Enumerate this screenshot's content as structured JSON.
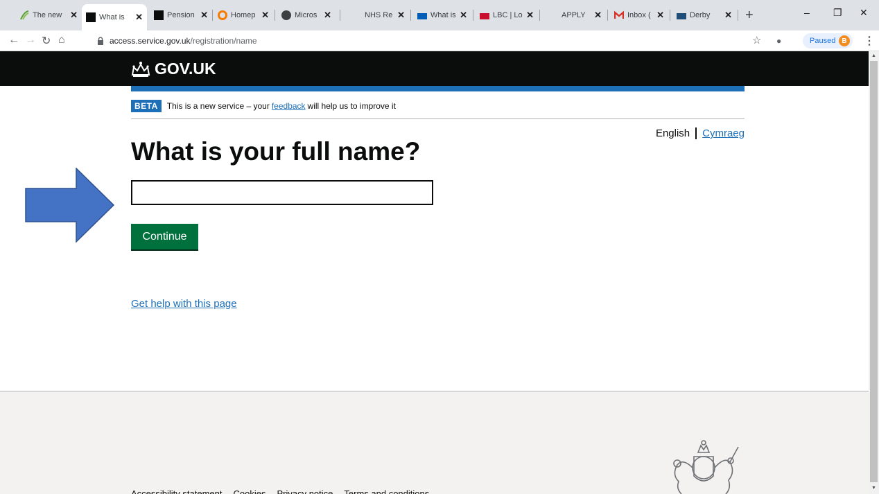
{
  "browser": {
    "tabs": [
      {
        "label": "The new",
        "active": false
      },
      {
        "label": "What is",
        "active": true
      },
      {
        "label": "Pension",
        "active": false
      },
      {
        "label": "Homep",
        "active": false
      },
      {
        "label": "Micros",
        "active": false
      },
      {
        "label": "NHS Re",
        "active": false
      },
      {
        "label": "What is",
        "active": false
      },
      {
        "label": "LBC | Lo",
        "active": false
      },
      {
        "label": "APPLY",
        "active": false
      },
      {
        "label": "Inbox (",
        "active": false
      },
      {
        "label": "Derby",
        "active": false
      }
    ],
    "close_glyph": "✕",
    "new_tab": "+",
    "url_host": "access.service.gov.uk",
    "url_path": "/registration/name",
    "profile_status": "Paused",
    "profile_initial": "B"
  },
  "page": {
    "logo_text": "GOV.UK",
    "beta_tag": "BETA",
    "beta_before": "This is a new service – your",
    "beta_link": "feedback",
    "beta_after": "will help us to improve it",
    "lang_current": "English",
    "lang_other": "Cymraeg",
    "heading": "What is your full name?",
    "name_value": "",
    "continue_label": "Continue",
    "help_link": "Get help with this page",
    "footer_links": [
      "Accessibility statement",
      "Cookies",
      "Privacy notice",
      "Terms and conditions"
    ]
  },
  "colors": {
    "gov_black": "#0b0c0c",
    "gov_blue": "#1d70b8",
    "gov_green": "#00703c",
    "arrow_fill": "#4472c4"
  }
}
